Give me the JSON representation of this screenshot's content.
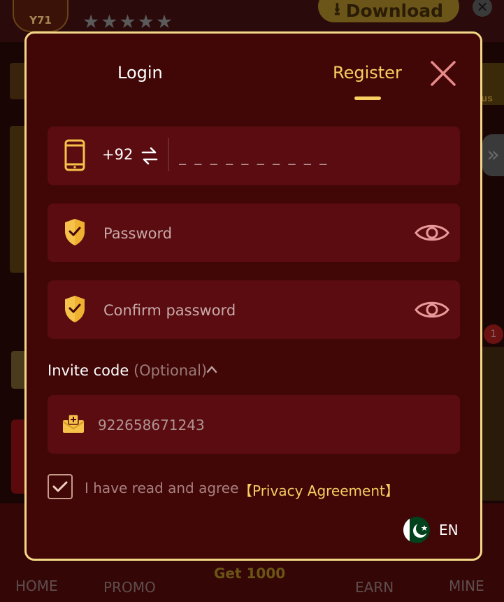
{
  "background": {
    "logo_text": "Y71",
    "stars": "★★★★★",
    "download_label": "Download",
    "close_glyph": "✕",
    "side_label": "us",
    "arrow_glyph": "»",
    "badge": "1",
    "nav": {
      "home": "HOME",
      "promo": "PROMO",
      "get": "Get 1000",
      "earn": "EARN",
      "mine": "MINE"
    }
  },
  "modal": {
    "tabs": {
      "login": "Login",
      "register": "Register",
      "active": "register"
    },
    "phone": {
      "country_code": "+92",
      "placeholder": "_ _ _ _ _ _ _ _ _ _"
    },
    "password": {
      "placeholder": "Password"
    },
    "confirm_password": {
      "placeholder": "Confirm password"
    },
    "invite": {
      "label": "Invite code",
      "optional": "(Optional)",
      "placeholder": "922658671243"
    },
    "agreement": {
      "text": "I have read and agree",
      "link": "【Privacy Agreement】",
      "checked": true
    },
    "language": {
      "code": "EN",
      "flag": "pakistan-flag-icon"
    }
  },
  "colors": {
    "accent": "#f6cf62",
    "modal_bg": "#410606",
    "field_bg": "#5a0c10",
    "border": "#f3d789",
    "eye": "#e89a9a"
  }
}
